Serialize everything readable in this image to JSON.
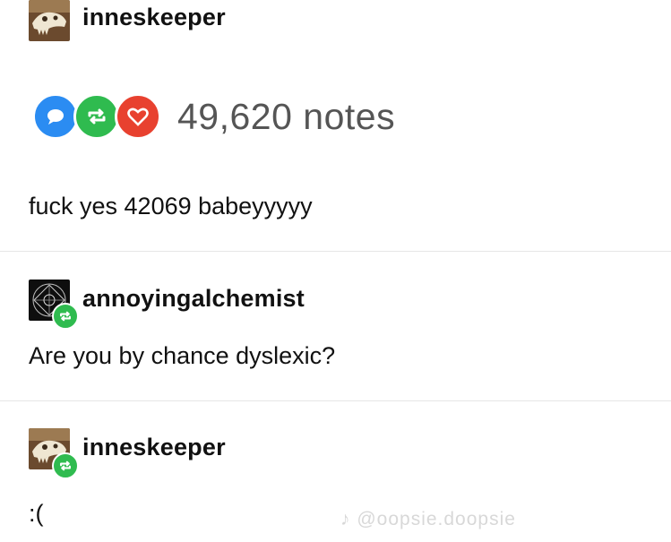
{
  "post1": {
    "username": "inneskeeper",
    "notes": "49,620 notes",
    "text": "fuck yes 42069 babeyyyyy"
  },
  "post2": {
    "username": "annoyingalchemist",
    "text": "Are you by chance dyslexic?"
  },
  "post3": {
    "username": "inneskeeper",
    "text": ":("
  },
  "watermark": "@oopsie.doopsie",
  "icons": {
    "comment": "comment-bubble-icon",
    "reblog": "reblog-icon",
    "like": "heart-icon"
  },
  "colors": {
    "comment": "#2b8cf2",
    "reblog": "#2fbb4f",
    "like": "#e8412f"
  }
}
